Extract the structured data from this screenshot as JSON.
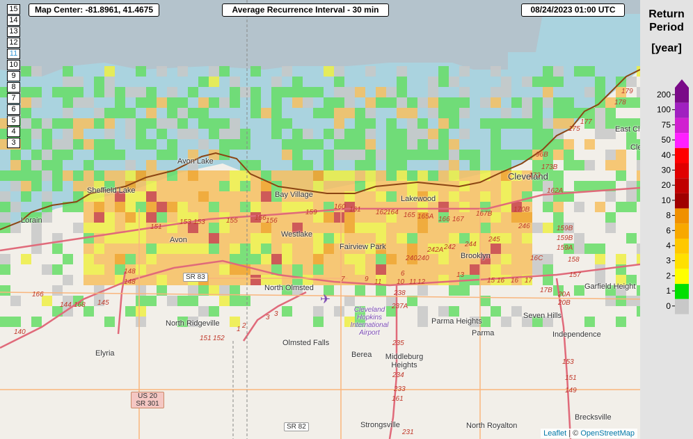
{
  "zoom_levels": [
    "15",
    "14",
    "13",
    "12",
    "11",
    "10",
    "9",
    "8",
    "7",
    "6",
    "5",
    "4",
    "3"
  ],
  "active_zoom": "11",
  "map_center": "Map Center: -81.8961, 41.4675",
  "title": "Average Recurrence Interval - 30 min",
  "datetime": "08/24/2023   01:00 UTC",
  "attribution": {
    "leaflet": "Leaflet",
    "sep": " | © ",
    "osm": "OpenStreetMap"
  },
  "legend": {
    "title1": "Return",
    "title2": "Period",
    "unit": "[year]",
    "ticks": [
      "200",
      "100",
      "75",
      "50",
      "40",
      "30",
      "20",
      "10",
      "8",
      "6",
      "4",
      "3",
      "2",
      "1",
      "0"
    ]
  },
  "colors": {
    "water": "#aad3df",
    "lake_missing": "#b4c3cc",
    "grey_cell": "#c8c8c8",
    "green": "#66dd66",
    "yellow": "#eeee44",
    "light_orange": "#f7c060",
    "orange": "#f0a020",
    "red": "#c84040",
    "boundary": "#8b4513",
    "legend_scale": [
      "#7a0a88",
      "#a020c0",
      "#d020d0",
      "#ff20ff",
      "#ff0000",
      "#e00000",
      "#c00000",
      "#a00000",
      "#f09000",
      "#f8a800",
      "#ffc800",
      "#ffe000",
      "#ffff00",
      "#00e000",
      "#c8c8c8"
    ]
  },
  "places": {
    "avon_lake": "Avon Lake",
    "sheffield_lake": "Sheffield Lake",
    "lorain": "Lorain",
    "bay_village": "Bay Village",
    "lakewood": "Lakewood",
    "cleveland": "Cleveland",
    "east_cl": "East Cl",
    "cle": "Cle",
    "westlake": "Westlake",
    "avon": "Avon",
    "fairview_park": "Fairview Park",
    "brooklyn": "Brooklyn",
    "north_olmsted": "North Olmsted",
    "garfield_heights": "Garfield Height",
    "airport": "Cleveland Hopkins International Airport",
    "north_ridgeville": "North Ridgeville",
    "parma_heights": "Parma Heights",
    "seven_hills": "Seven Hills",
    "parma": "Parma",
    "independence": "Independence",
    "olmsted_falls": "Olmsted Falls",
    "berea": "Berea",
    "middleburg_heights": "Middleburg Heights",
    "elyria": "Elyria",
    "strongsville": "Strongsville",
    "north_royalton": "North Royalton",
    "brecksville": "Brecksville"
  },
  "shields": {
    "sr83": "SR 83",
    "us20": "US 20",
    "sr301": "SR 301",
    "sr82": "SR 82"
  },
  "routes": [
    "179",
    "178",
    "177",
    "175",
    "96B",
    "173B",
    "173",
    "162A",
    "160",
    "161",
    "162",
    "164",
    "165",
    "165A",
    "166",
    "167",
    "167B",
    "170B",
    "153",
    "155",
    "156",
    "158",
    "159",
    "151",
    "246",
    "159B",
    "159A",
    "158",
    "148",
    "240",
    "242A",
    "242",
    "244",
    "245",
    "16C",
    "17B",
    "20A",
    "20B",
    "157",
    "153",
    "151",
    "149",
    "166",
    "144",
    "168",
    "145",
    "140",
    "7",
    "9",
    "11",
    "10",
    "12",
    "13",
    "15",
    "16",
    "17",
    "6",
    "238",
    "237A",
    "235",
    "234",
    "233",
    "161",
    "231",
    "3",
    "2",
    "1",
    "152",
    "151"
  ]
}
